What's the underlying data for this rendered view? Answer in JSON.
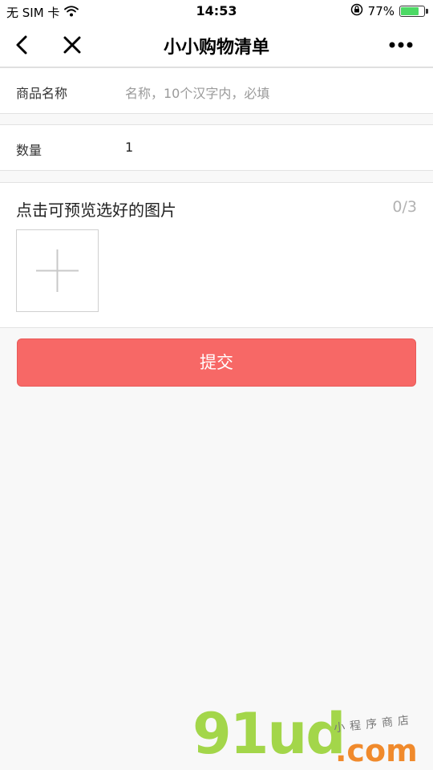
{
  "status_bar": {
    "carrier": "无 SIM 卡",
    "time": "14:53",
    "battery_percent": "77%",
    "battery_level": 0.77,
    "icons": [
      "wifi-icon",
      "rotation-lock-icon",
      "battery-icon"
    ]
  },
  "nav": {
    "title": "小小购物清单",
    "icons": [
      "back-icon",
      "close-icon",
      "more-icon"
    ]
  },
  "form": {
    "name_label": "商品名称",
    "name_placeholder": "名称，10个汉字内，必填",
    "quantity_label": "数量",
    "quantity_value": "1"
  },
  "images": {
    "title": "点击可预览选好的图片",
    "count": "0/3",
    "add_icon": "plus-icon"
  },
  "submit_label": "提交",
  "watermark": {
    "brand": "91ud",
    "domain": ".com",
    "slogan": "小程序商店"
  },
  "colors": {
    "accent": "#f76866",
    "battery": "#4cd964",
    "placeholder": "#9a9a9a"
  }
}
